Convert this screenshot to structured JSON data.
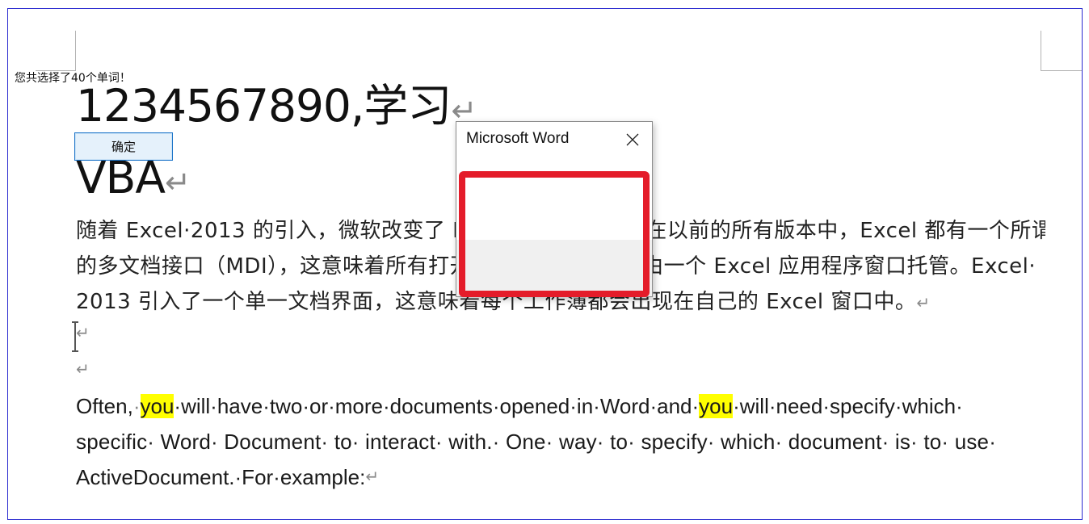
{
  "document": {
    "heading1": "1234567890,学习",
    "heading2": "VBA",
    "para_mark": "↵",
    "cn_lines": [
      "随着 Excel·2013 的引入，微软改变了 Excel 的窗口方式。在以前的所有版本中，Excel 都有一个所谓",
      "的多文档接口（MDI），这意味着所有打开的工作簿都在一个由一个 Excel 应用程序窗口托管。Excel·",
      "2013 引入了一个单一文档界面，这意味着每个工作簿都会出现在自己的 Excel 窗口中。"
    ],
    "en_lines": [
      [
        "Often,",
        "·",
        "you",
        "·will·have·two·or·more·documents·opened·in·Word·and·",
        "you",
        "·will·need·specify·which·"
      ],
      "specific· Word· Document· to· interact· with.· One· way· to· specify· which· document· is· to· use·",
      "ActiveDocument.·For·example:"
    ],
    "highlight_color": "#ffff00"
  },
  "dialog": {
    "title": "Microsoft Word",
    "message": "您共选择了40个单词！",
    "ok_label": "确定",
    "close_icon": "close-icon"
  },
  "annotation_color": "#e41c2a"
}
